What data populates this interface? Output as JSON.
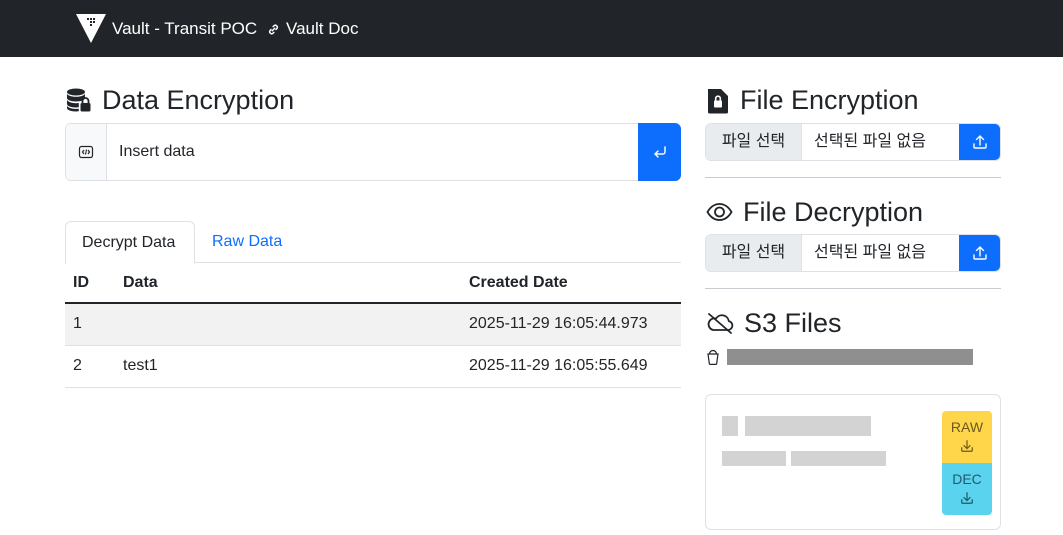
{
  "navbar": {
    "brand_text": "Vault - Transit POC",
    "doc_link": "Vault Doc"
  },
  "data_encryption": {
    "title": "Data Encryption",
    "placeholder": "Insert data"
  },
  "tabs": [
    {
      "label": "Decrypt Data",
      "active": true
    },
    {
      "label": "Raw Data",
      "active": false
    }
  ],
  "table": {
    "headers": [
      "ID",
      "Data",
      "Created Date"
    ],
    "rows": [
      {
        "id": "1",
        "data": "",
        "created": "2025-11-29 16:05:44.973"
      },
      {
        "id": "2",
        "data": "test1",
        "created": "2025-11-29 16:05:55.649"
      }
    ]
  },
  "file_encryption": {
    "title": "File Encryption",
    "choose_label": "파일 선택",
    "no_file_label": "선택된 파일 없음"
  },
  "file_decryption": {
    "title": "File Decryption",
    "choose_label": "파일 선택",
    "no_file_label": "선택된 파일 없음"
  },
  "s3_files": {
    "title": "S3 Files",
    "raw_label": "RAW",
    "dec_label": "DEC"
  },
  "colors": {
    "navbar": "#212529",
    "primary": "#0d6efd",
    "raw_button": "#ffd54a",
    "dec_button": "#5ad3ee"
  },
  "icons": {
    "brand": "vault-logo-icon",
    "doc_link": "link-icon",
    "data_encryption": "database-lock-icon",
    "input_prefix": "code-icon",
    "submit": "enter-icon",
    "file_encryption": "file-lock-icon",
    "file_decryption": "eye-icon",
    "upload": "upload-icon",
    "s3": "cloud-slash-icon",
    "bucket": "bucket-icon",
    "download": "download-icon"
  }
}
